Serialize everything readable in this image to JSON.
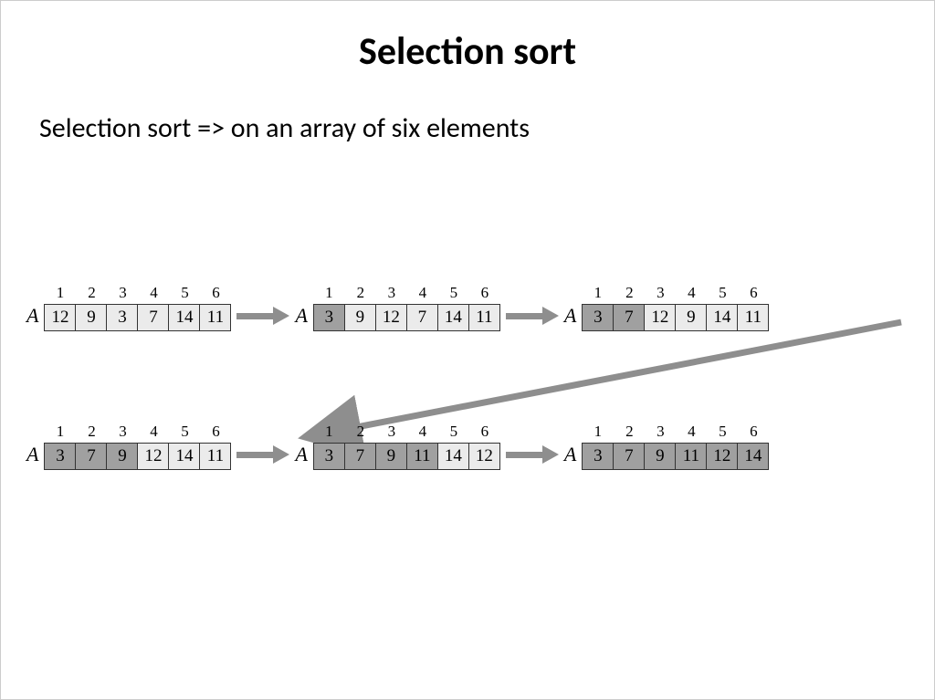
{
  "title": "Selection sort",
  "subtitle": "Selection sort => on an array of six elements",
  "arrayLabel": "A",
  "indices": [
    "1",
    "2",
    "3",
    "4",
    "5",
    "6"
  ],
  "colors": {
    "light": "#ebebeb",
    "dark": "#a0a0a0",
    "arrow": "#8e8e8e"
  },
  "arrays": [
    {
      "values": [
        "12",
        "9",
        "3",
        "7",
        "14",
        "11"
      ],
      "shaded": [
        false,
        false,
        false,
        false,
        false,
        false
      ]
    },
    {
      "values": [
        "3",
        "9",
        "12",
        "7",
        "14",
        "11"
      ],
      "shaded": [
        true,
        false,
        false,
        false,
        false,
        false
      ]
    },
    {
      "values": [
        "3",
        "7",
        "12",
        "9",
        "14",
        "11"
      ],
      "shaded": [
        true,
        true,
        false,
        false,
        false,
        false
      ]
    },
    {
      "values": [
        "3",
        "7",
        "9",
        "12",
        "14",
        "11"
      ],
      "shaded": [
        true,
        true,
        true,
        false,
        false,
        false
      ]
    },
    {
      "values": [
        "3",
        "7",
        "9",
        "11",
        "14",
        "12"
      ],
      "shaded": [
        true,
        true,
        true,
        true,
        false,
        false
      ]
    },
    {
      "values": [
        "3",
        "7",
        "9",
        "11",
        "12",
        "14"
      ],
      "shaded": [
        true,
        true,
        true,
        true,
        true,
        true
      ]
    }
  ]
}
